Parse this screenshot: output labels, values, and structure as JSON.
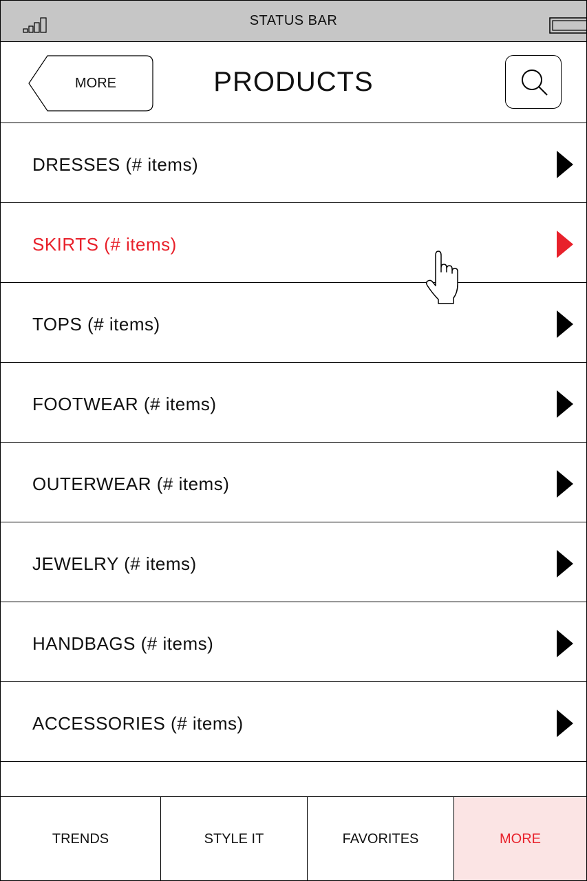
{
  "status_bar": {
    "title": "STATUS BAR"
  },
  "header": {
    "back_label": "MORE",
    "title": "PRODUCTS",
    "search_icon": "search-icon"
  },
  "list": {
    "items": [
      {
        "label": "DRESSES (# items)",
        "active": false
      },
      {
        "label": "SKIRTS (# items)",
        "active": true
      },
      {
        "label": "TOPS (# items)",
        "active": false
      },
      {
        "label": "FOOTWEAR (# items)",
        "active": false
      },
      {
        "label": "OUTERWEAR (# items)",
        "active": false
      },
      {
        "label": "JEWELRY (# items)",
        "active": false
      },
      {
        "label": "HANDBAGS (# items)",
        "active": false
      },
      {
        "label": "ACCESSORIES (# items)",
        "active": false
      }
    ]
  },
  "tabs": [
    {
      "label": "TRENDS",
      "active": false
    },
    {
      "label": "STYLE IT",
      "active": false
    },
    {
      "label": "FAVORITES",
      "active": false
    },
    {
      "label": "MORE",
      "active": true
    }
  ],
  "colors": {
    "accent": "#e8212b",
    "active_tab_bg": "#fbe4e4",
    "status_bar_bg": "#c6c6c6"
  }
}
